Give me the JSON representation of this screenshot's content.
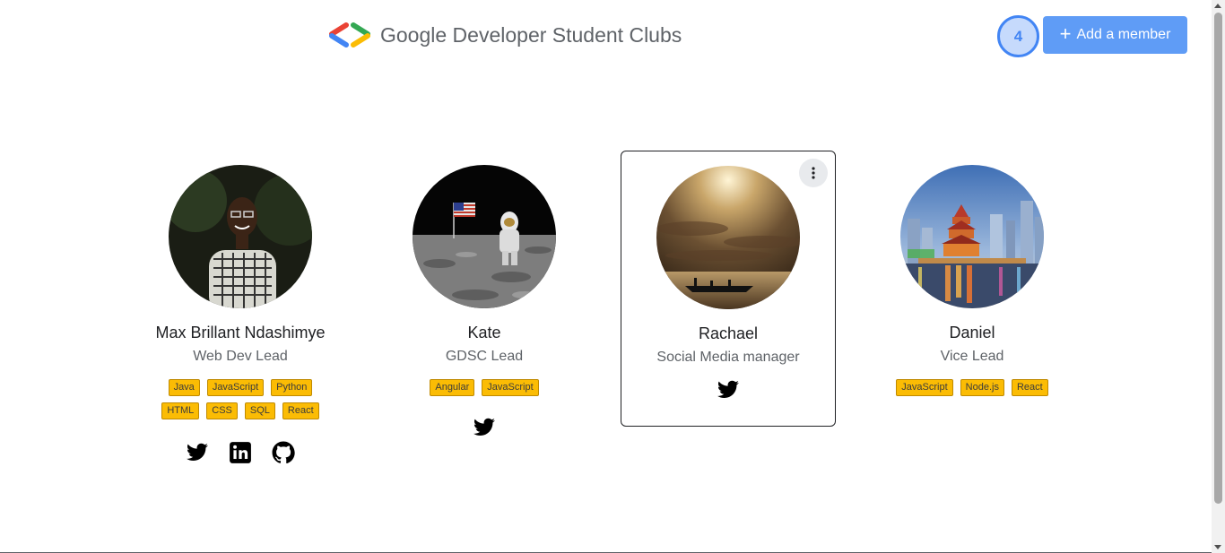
{
  "header": {
    "logo_text": "Google Developer Student Clubs",
    "member_count": "4",
    "add_button_label": "Add a member"
  },
  "colors": {
    "accent_blue": "#4285f4",
    "tag_yellow": "#fbbc04",
    "button_blue": "#5f9cf6"
  },
  "members": [
    {
      "name": "Max Brillant Ndashimye",
      "role": "Web Dev Lead",
      "tags": [
        "Java",
        "JavaScript",
        "Python",
        "HTML",
        "CSS",
        "SQL",
        "React"
      ],
      "socials": [
        "twitter-icon",
        "linkedin-icon",
        "github-icon"
      ]
    },
    {
      "name": "Kate",
      "role": "GDSC Lead",
      "tags": [
        "Angular",
        "JavaScript"
      ],
      "socials": [
        "twitter-icon"
      ]
    },
    {
      "name": "Rachael",
      "role": "Social Media manager",
      "tags": [],
      "socials": [
        "twitter-icon"
      ]
    },
    {
      "name": "Daniel",
      "role": "Vice Lead",
      "tags": [
        "JavaScript",
        "Node.js",
        "React"
      ],
      "socials": []
    }
  ]
}
